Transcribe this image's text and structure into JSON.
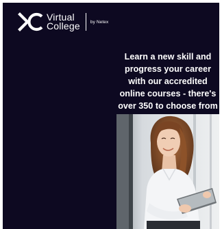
{
  "brand": {
    "logo_icon": "virtual-college-chevron-c-logo",
    "name_line1": "Virtual",
    "name_line2": "College",
    "byline": "by Netex"
  },
  "hero": {
    "headline": "Learn a new skill and\nprogress your career\nwith our accredited\nonline courses - there's\nover 350 to choose from",
    "photo_subject": "woman-smiling-with-tablet"
  },
  "colors": {
    "page_bg": "#ffffff",
    "banner_bg": "#0d0921",
    "text": "#ffffff"
  }
}
